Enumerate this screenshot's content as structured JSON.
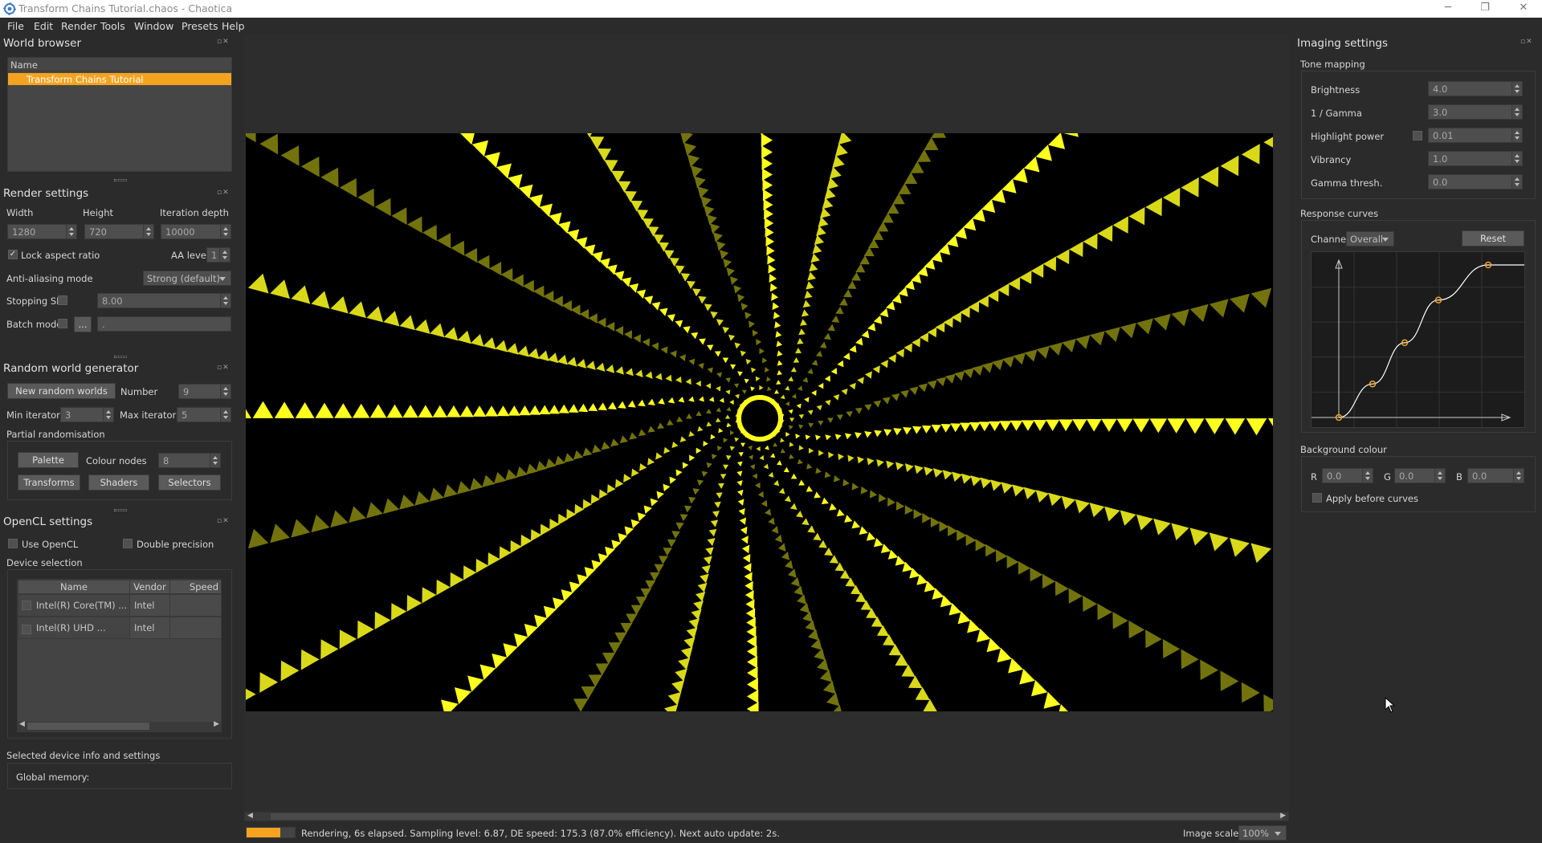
{
  "window": {
    "title": "Transform Chains Tutorial.chaos - Chaotica",
    "minimize": "─",
    "restore": "❐",
    "close": "✕"
  },
  "menu": [
    "File",
    "Edit",
    "Render",
    "Tools",
    "Window",
    "Presets",
    "Help"
  ],
  "world_browser": {
    "title": "World browser",
    "column": "Name",
    "items": [
      "Transform Chains Tutorial"
    ]
  },
  "render_settings": {
    "title": "Render settings",
    "width_label": "Width",
    "height_label": "Height",
    "depth_label": "Iteration depth",
    "width": "1280",
    "height": "720",
    "depth": "10000",
    "lock_aspect": "Lock aspect ratio",
    "lock_checked": "✓",
    "aa_level_label": "AA level",
    "aa_level": "1",
    "aa_mode_label": "Anti-aliasing mode",
    "aa_mode": "Strong (default)",
    "stopping_label": "Stopping SL",
    "stopping_value": "8.00",
    "batch_label": "Batch mode",
    "batch_button": "...",
    "batch_value": "."
  },
  "random_world": {
    "title": "Random world generator",
    "new_button": "New random worlds",
    "number_label": "Number",
    "number": "9",
    "min_label": "Min iterators",
    "min": "3",
    "max_label": "Max iterators",
    "max": "5",
    "partial_label": "Partial randomisation",
    "palette_button": "Palette",
    "colour_nodes_label": "Colour nodes",
    "colour_nodes": "8",
    "transforms_button": "Transforms",
    "shaders_button": "Shaders",
    "selectors_button": "Selectors"
  },
  "opencl": {
    "title": "OpenCL settings",
    "use_label": "Use OpenCL",
    "double_label": "Double precision",
    "device_selection": "Device selection",
    "columns": [
      "Name",
      "Vendor",
      "Speed"
    ],
    "devices": [
      {
        "name": "Intel(R) Core(TM) ...",
        "vendor": "Intel",
        "speed": ""
      },
      {
        "name": "Intel(R) UHD ...",
        "vendor": "Intel",
        "speed": ""
      }
    ],
    "info_label": "Selected device info and settings",
    "global_memory": "Global memory:"
  },
  "imaging": {
    "title": "Imaging settings",
    "tone_mapping": "Tone mapping",
    "fields": [
      {
        "label": "Brightness",
        "value": "4.0"
      },
      {
        "label": "1 / Gamma",
        "value": "3.0"
      },
      {
        "label": "Highlight power",
        "value": "0.01"
      },
      {
        "label": "Vibrancy",
        "value": "1.0"
      },
      {
        "label": "Gamma thresh.",
        "value": "0.0"
      }
    ],
    "response_curves": "Response curves",
    "channel_label": "Channel:",
    "channel": "Overall",
    "reset_button": "Reset",
    "curve_points": [
      [
        0,
        0
      ],
      [
        0.21,
        0.22
      ],
      [
        0.41,
        0.49
      ],
      [
        0.62,
        0.77
      ],
      [
        0.93,
        1.0
      ]
    ],
    "background_colour": "Background colour",
    "r_label": "R",
    "r": "0.0",
    "g_label": "G",
    "g": "0.0",
    "b_label": "B",
    "b": "0.0",
    "apply_before": "Apply before curves"
  },
  "render": {
    "background": "#000000",
    "flame_color": "#ffff1e",
    "arms": 24
  },
  "status": {
    "progress": 0.7,
    "text": "Rendering, 6s elapsed. Sampling level: 6.87, DE speed: 175.3 (87.0% efficiency). Next auto update: 2s.",
    "image_scale_label": "Image scale:",
    "image_scale": "100%"
  },
  "colors": {
    "accent": "#f4a321",
    "panel": "#2b2b2b"
  }
}
